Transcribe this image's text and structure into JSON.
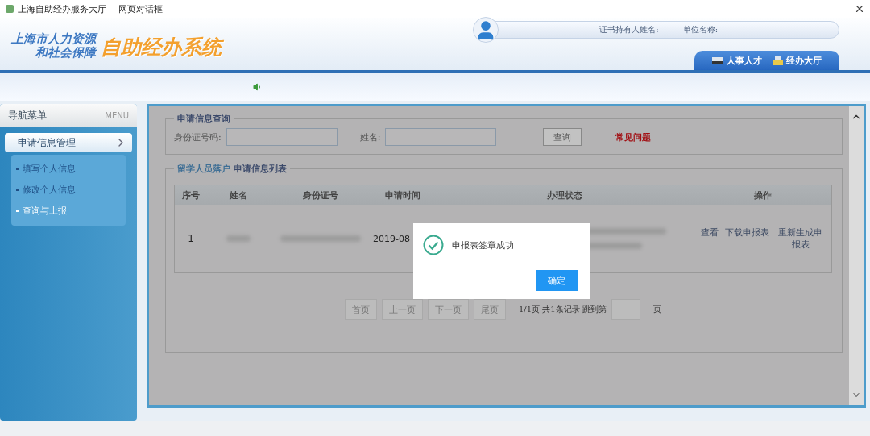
{
  "window": {
    "title": "上海自助经办服务大厅 -- 网页对话框"
  },
  "header": {
    "org_line1": "上海市人力资源",
    "org_line2": "和社会保障",
    "system_name": "自助经办系统",
    "holder_label": "证书持有人姓名:",
    "unit_label": "单位名称:",
    "nav_tabs": [
      {
        "label": "人事人才",
        "kind": "card"
      },
      {
        "label": "经办大厅",
        "kind": "printer"
      }
    ]
  },
  "sidebar": {
    "title": "导航菜单",
    "title_en": "MENU",
    "sections": [
      {
        "label": "申请信息管理",
        "expanded": true,
        "children": [
          {
            "label": "填写个人信息",
            "selected": false
          },
          {
            "label": "修改个人信息",
            "selected": false
          },
          {
            "label": "查询与上报",
            "selected": true
          }
        ]
      }
    ]
  },
  "query": {
    "legend": "申请信息查询",
    "id_label": "身份证号码:",
    "name_label": "姓名:",
    "search_button": "查询",
    "faq_link": "常见问题"
  },
  "list": {
    "legend_prefix": "留学人员落户",
    "legend": "申请信息列表",
    "columns": [
      "序号",
      "姓名",
      "身份证号",
      "申请时间",
      "办理状态",
      "操作"
    ],
    "rows": [
      {
        "index": "1",
        "date": "2019-08",
        "actions": [
          "查看",
          "下载申报表",
          "重新生成申报表"
        ]
      }
    ]
  },
  "pagination": {
    "buttons": [
      "首页",
      "上一页",
      "下一页",
      "尾页"
    ],
    "info": "1/1页 共1条记录 跳到第",
    "suffix": "页"
  },
  "dialog": {
    "message": "申报表签章成功",
    "ok": "确定"
  }
}
